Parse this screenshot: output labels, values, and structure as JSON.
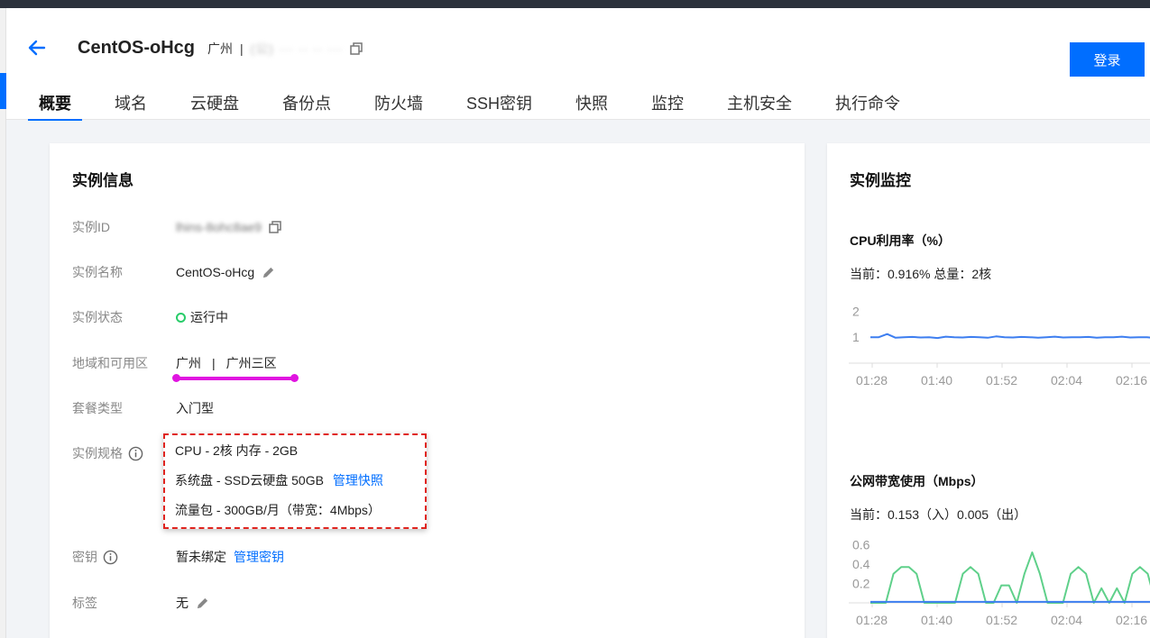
{
  "header": {
    "title": "CentOS-oHcg",
    "region": "广州",
    "separator": "|",
    "ip_masked": "(公) ··· ·· ·· ···",
    "login_label": "登录"
  },
  "tabs": [
    {
      "label": "概要",
      "active": true
    },
    {
      "label": "域名"
    },
    {
      "label": "云硬盘"
    },
    {
      "label": "备份点"
    },
    {
      "label": "防火墙"
    },
    {
      "label": "SSH密钥"
    },
    {
      "label": "快照"
    },
    {
      "label": "监控"
    },
    {
      "label": "主机安全"
    },
    {
      "label": "执行命令"
    }
  ],
  "info": {
    "title": "实例信息",
    "id_label": "实例ID",
    "id_value": "lhins-8ohc8ae9",
    "name_label": "实例名称",
    "name_value": "CentOS-oHcg",
    "status_label": "实例状态",
    "status_value": "运行中",
    "region_label": "地域和可用区",
    "region_value": "广州",
    "region_sep": "|",
    "zone_value": "广州三区",
    "plan_label": "套餐类型",
    "plan_value": "入门型",
    "spec_label": "实例规格",
    "spec_cpu": "CPU - 2核 内存 - 2GB",
    "spec_disk": "系统盘 - SSD云硬盘 50GB",
    "spec_disk_link": "管理快照",
    "spec_traffic": "流量包 - 300GB/月（带宽：4Mbps）",
    "key_label": "密钥",
    "key_value": "暂未绑定",
    "key_link": "管理密钥",
    "tag_label": "标签",
    "tag_value": "无"
  },
  "monitor": {
    "title": "实例监控",
    "cpu_title": "CPU利用率（%）",
    "cpu_current": "当前：0.916% 总量：2核",
    "bw_title": "公网带宽使用（Mbps）",
    "bw_current": "当前：0.153（入）0.005（出）"
  },
  "colors": {
    "accent": "#006eff",
    "status": "#29cc6a",
    "line_blue": "#3d7ef0",
    "line_green": "#5fd08a",
    "annotation_red": "#e0241f",
    "annotation_magenta": "#e014e0"
  },
  "chart_data": [
    {
      "type": "line",
      "title": "CPU利用率（%）",
      "x": [
        "01:28",
        "01:40",
        "01:52",
        "02:04",
        "02:16"
      ],
      "yticks": [
        1,
        2
      ],
      "ylim": [
        0,
        2.5
      ],
      "series": [
        {
          "values": [
            1.0,
            1.0,
            1.12,
            0.98,
            1.0,
            1.01,
            0.99,
            1.0,
            0.97,
            1.02,
            1.0,
            0.99,
            1.01,
            1.0,
            0.98,
            1.03,
            1.0,
            0.99,
            1.01,
            1.0,
            0.98,
            1.0,
            1.02,
            0.99,
            1.0,
            1.0,
            1.01,
            0.98,
            1.0,
            1.0,
            1.02,
            0.99,
            1.0,
            1.0,
            0.97
          ]
        }
      ]
    },
    {
      "type": "line",
      "title": "公网带宽使用（Mbps）",
      "x": [
        "01:28",
        "01:40",
        "01:52",
        "02:04",
        "02:16"
      ],
      "yticks": [
        0.2,
        0.4,
        0.6
      ],
      "ylim": [
        0,
        0.65
      ],
      "series": [
        {
          "values": [
            0.0,
            0.0,
            0.0,
            0.3,
            0.37,
            0.37,
            0.3,
            0.0,
            0.0,
            0.0,
            0.0,
            0.0,
            0.3,
            0.37,
            0.3,
            0.0,
            0.0,
            0.18,
            0.18,
            0.0,
            0.3,
            0.52,
            0.3,
            0.0,
            0.0,
            0.0,
            0.3,
            0.37,
            0.3,
            0.0,
            0.15,
            0.0,
            0.15,
            0.0,
            0.3,
            0.37,
            0.3,
            0.0
          ]
        },
        {
          "values": [
            0.01,
            0.01,
            0.01,
            0.01,
            0.01,
            0.01,
            0.01,
            0.01,
            0.01,
            0.01,
            0.01,
            0.01,
            0.01,
            0.01,
            0.01,
            0.01,
            0.01,
            0.01,
            0.01,
            0.01,
            0.01,
            0.01,
            0.01,
            0.01,
            0.01,
            0.01,
            0.01,
            0.01,
            0.01,
            0.01,
            0.01,
            0.01,
            0.01,
            0.01,
            0.01,
            0.01,
            0.01,
            0.01
          ]
        }
      ]
    }
  ]
}
